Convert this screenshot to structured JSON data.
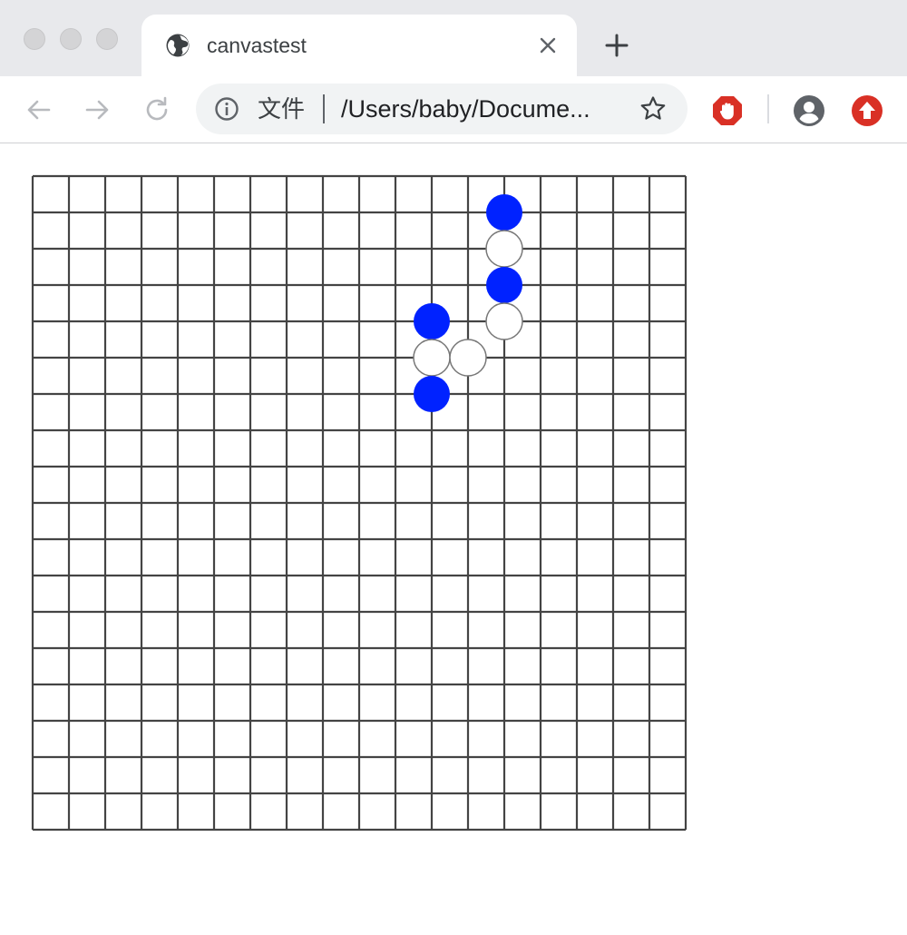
{
  "tab": {
    "title": "canvastest",
    "favicon": "globe-icon"
  },
  "toolbar": {
    "chip_label": "文件",
    "url": "/Users/baby/Docume..."
  },
  "colors": {
    "blue_stone": "#0022ff",
    "white_stone": "#ffffff",
    "grid_line": "#444444",
    "ext_red": "#d93025"
  },
  "board": {
    "columns": 19,
    "rows": 19,
    "stones": [
      {
        "col": 13,
        "row": 1,
        "color": "blue"
      },
      {
        "col": 13,
        "row": 2,
        "color": "white"
      },
      {
        "col": 13,
        "row": 3,
        "color": "blue"
      },
      {
        "col": 13,
        "row": 4,
        "color": "white"
      },
      {
        "col": 11,
        "row": 4,
        "color": "blue"
      },
      {
        "col": 11,
        "row": 5,
        "color": "white"
      },
      {
        "col": 12,
        "row": 5,
        "color": "white"
      },
      {
        "col": 11,
        "row": 6,
        "color": "blue"
      }
    ]
  }
}
